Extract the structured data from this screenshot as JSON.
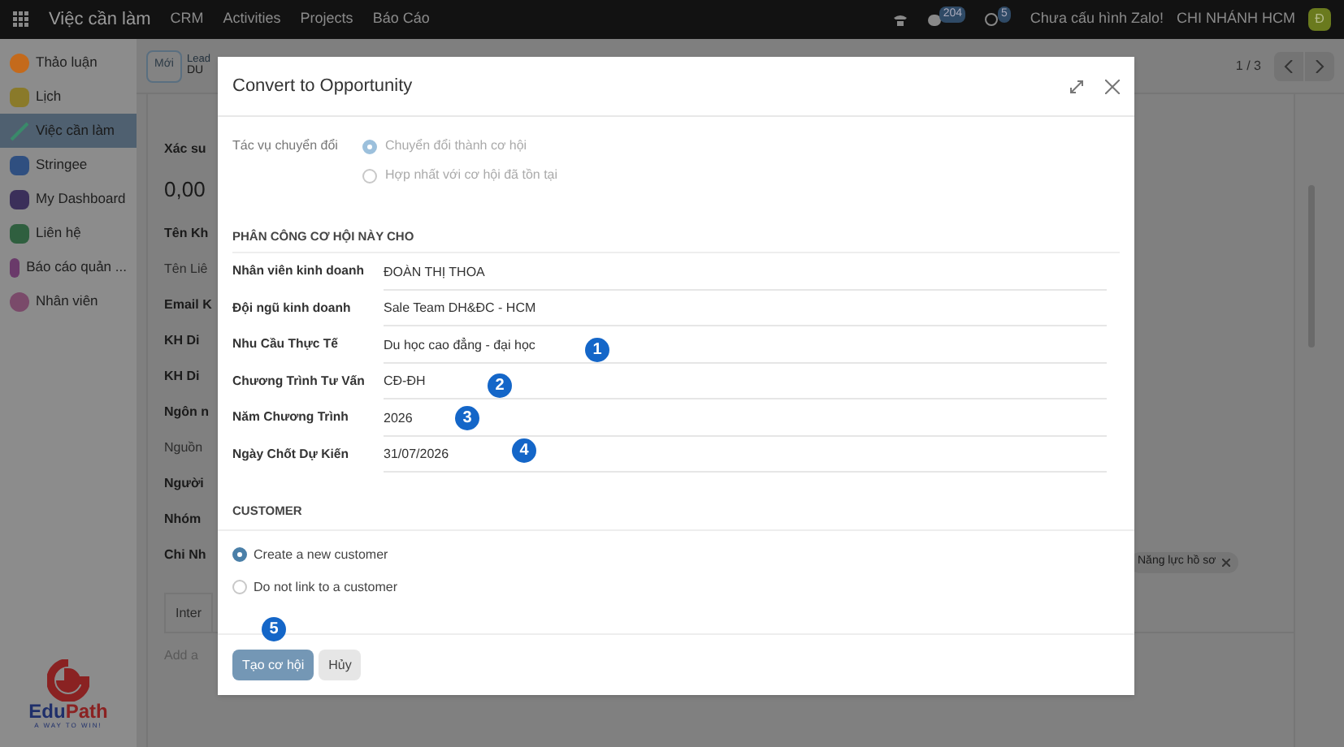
{
  "topbar": {
    "app": "Việc cần làm",
    "menu": [
      "CRM",
      "Activities",
      "Projects",
      "Báo Cáo"
    ],
    "chat_count": "204",
    "activity_count": "5",
    "zalo": "Chưa cấu hình Zalo!",
    "company": "CHI NHÁNH HCM",
    "avatar": "Đ"
  },
  "sidebar": {
    "items": [
      {
        "label": "Thảo luận",
        "selected": false
      },
      {
        "label": "Lịch",
        "selected": false
      },
      {
        "label": "Việc cần làm",
        "selected": true
      },
      {
        "label": "Stringee",
        "selected": false
      },
      {
        "label": "My Dashboard",
        "selected": false
      },
      {
        "label": "Liên hệ",
        "selected": false
      },
      {
        "label": "Báo cáo quản ...",
        "selected": false
      },
      {
        "label": "Nhân viên",
        "selected": false
      }
    ],
    "logo": {
      "wordmark": [
        "Edu",
        "Path"
      ],
      "tagline": "A WAY TO WIN!"
    }
  },
  "control_panel": {
    "new_button": "Mới",
    "breadcrumb": "Lead",
    "record": "DU",
    "pager": "1 / 3"
  },
  "form_background": {
    "fields": [
      {
        "text": "Xác su",
        "kind": "bold"
      },
      {
        "text": "0,00",
        "kind": "big"
      },
      {
        "text": "Tên Kh",
        "kind": "bold"
      },
      {
        "text": "Tên Liê",
        "kind": "light"
      },
      {
        "text": "Email K",
        "kind": "bold"
      },
      {
        "text": "KH Di",
        "kind": "bold"
      },
      {
        "text": "KH Di",
        "kind": "bold"
      },
      {
        "text": "Ngôn n",
        "kind": "bold"
      },
      {
        "text": "Nguồn",
        "kind": "light"
      },
      {
        "text": "Người",
        "kind": "bold"
      },
      {
        "text": "Nhóm",
        "kind": "bold"
      },
      {
        "text": "Chi Nh",
        "kind": "bold"
      }
    ],
    "tab": "Inter",
    "note": "Add a",
    "tag": "Năng lực hồ sơ"
  },
  "dialog": {
    "title": "Convert to Opportunity",
    "action_label": "Tác vụ chuyển đổi",
    "actions": [
      {
        "label": "Chuyển đổi thành cơ hội",
        "selected": true
      },
      {
        "label": "Hợp nhất với cơ hội đã tồn tại",
        "selected": false
      }
    ],
    "assign_heading": "PHÂN CÔNG CƠ HỘI NÀY CHO",
    "fields": [
      {
        "label": "Nhân viên kinh doanh",
        "value": "ĐOÀN THỊ THOA"
      },
      {
        "label": "Đội ngũ kinh doanh",
        "value": "Sale Team DH&ĐC - HCM"
      },
      {
        "label": "Nhu Cầu Thực Tế",
        "value": "Du học cao đẳng - đại học"
      },
      {
        "label": "Chương Trình Tư Vấn",
        "value": "CĐ-ĐH"
      },
      {
        "label": "Năm Chương Trình",
        "value": "2026"
      },
      {
        "label": "Ngày Chốt Dự Kiến",
        "value": "31/07/2026"
      }
    ],
    "customer_heading": "CUSTOMER",
    "customer_options": [
      {
        "label": "Create a new customer",
        "selected": true
      },
      {
        "label": "Do not link to a customer",
        "selected": false
      }
    ],
    "buttons": [
      "Tạo cơ hội",
      "Hủy"
    ]
  },
  "markers": [
    "1",
    "2",
    "3",
    "4",
    "5"
  ]
}
